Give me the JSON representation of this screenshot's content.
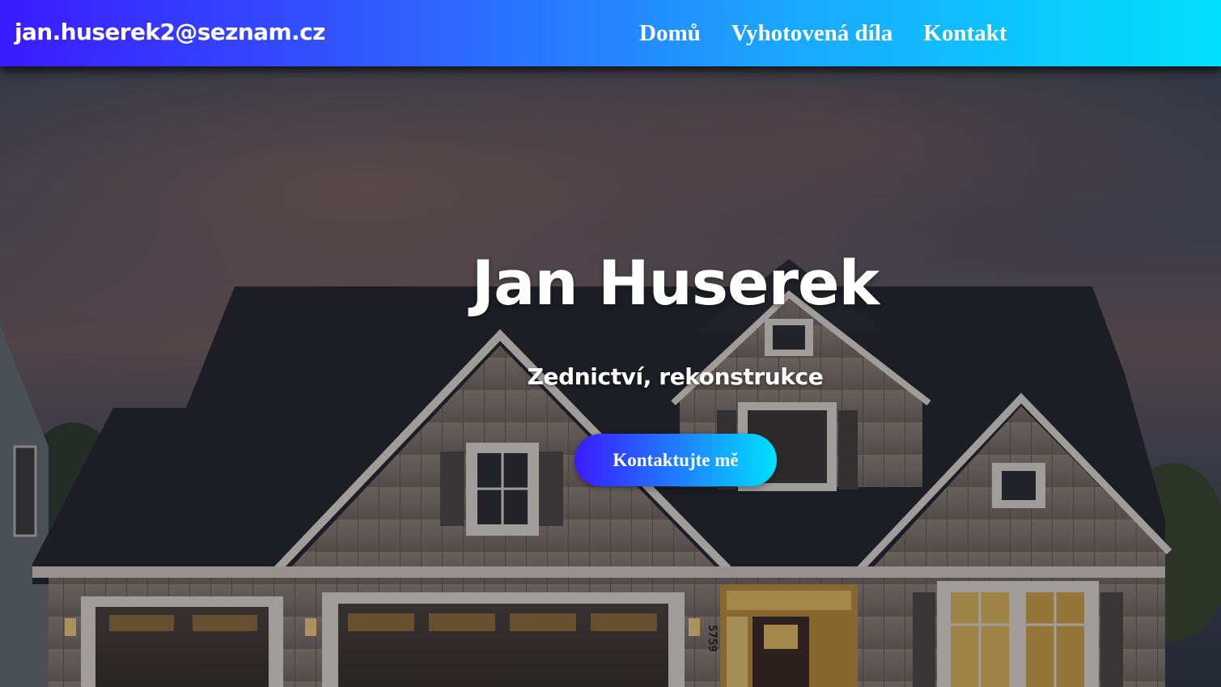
{
  "header": {
    "brand": "jan.huserek2@seznam.cz",
    "nav": [
      {
        "label": "Domů"
      },
      {
        "label": "Vyhotovená díla"
      },
      {
        "label": "Kontakt"
      }
    ]
  },
  "hero": {
    "title": "Jan Huserek",
    "subtitle": "Zednictví, rekonstrukce",
    "cta_label": "Kontaktujte mě",
    "house_number": "5759"
  },
  "colors": {
    "gradient_start": "#3a1bff",
    "gradient_end": "#00e0ff",
    "text": "#ffffff"
  }
}
